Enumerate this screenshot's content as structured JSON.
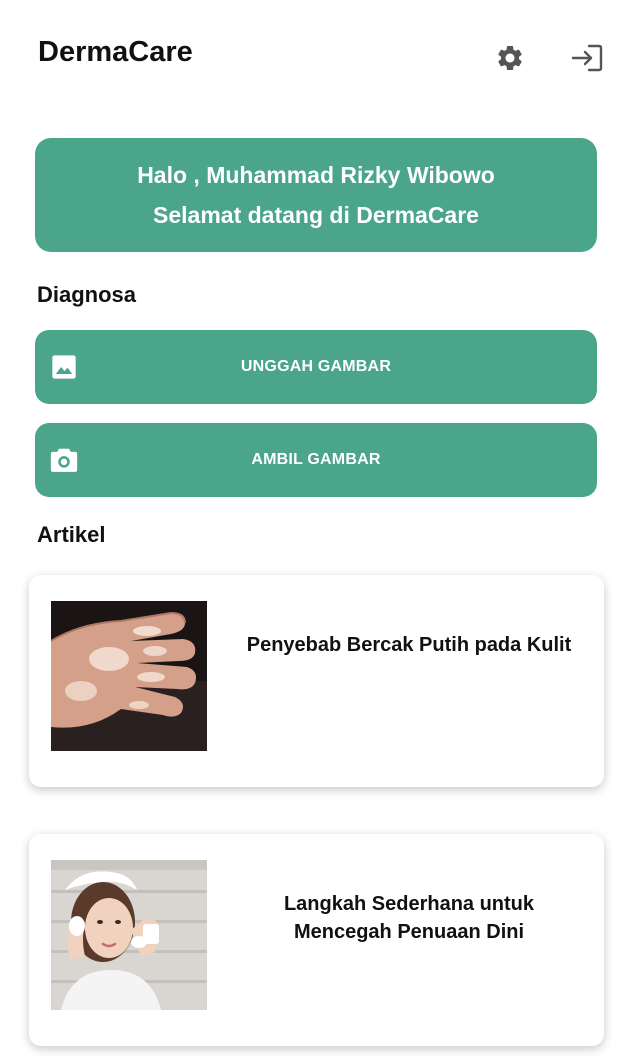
{
  "app": {
    "title": "DermaCare",
    "accent_color": "#4aa58a"
  },
  "header": {
    "settings_icon": "gear-icon",
    "logout_icon": "logout-icon"
  },
  "welcome": {
    "greeting": "Halo , Muhammad Rizky Wibowo",
    "subtitle": "Selamat datang di DermaCare"
  },
  "diagnosa": {
    "title": "Diagnosa",
    "upload_label": "UNGGAH GAMBAR",
    "upload_icon": "image-icon",
    "camera_label": "AMBIL GAMBAR",
    "camera_icon": "camera-icon"
  },
  "artikel": {
    "title": "Artikel",
    "items": [
      {
        "title": "Penyebab Bercak Putih pada Kulit",
        "thumb": "hand-skin-patches-image"
      },
      {
        "title": "Langkah Sederhana untuk Mencegah Penuaan Dini",
        "thumb": "woman-face-washing-image"
      }
    ]
  }
}
